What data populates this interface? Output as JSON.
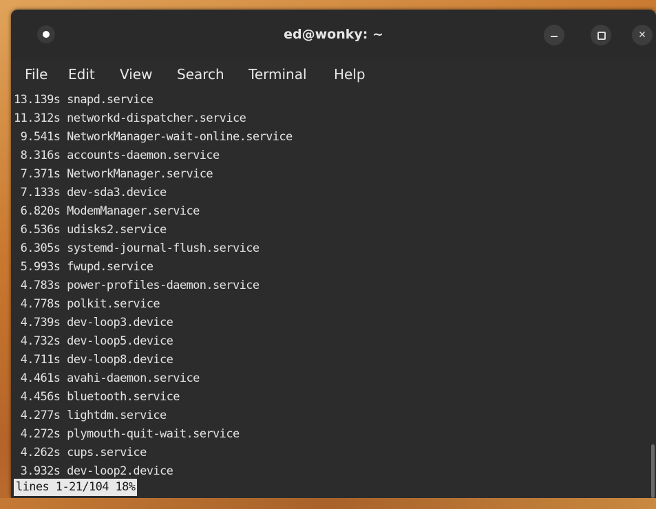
{
  "window": {
    "title": "ed@wonky: ~"
  },
  "menu": {
    "items": [
      {
        "label": "File"
      },
      {
        "label": "Edit"
      },
      {
        "label": "View"
      },
      {
        "label": "Search"
      },
      {
        "label": "Terminal"
      },
      {
        "label": "Help"
      }
    ]
  },
  "terminal": {
    "lines": [
      "13.139s snapd.service",
      "11.312s networkd-dispatcher.service",
      " 9.541s NetworkManager-wait-online.service",
      " 8.316s accounts-daemon.service",
      " 7.371s NetworkManager.service",
      " 7.133s dev-sda3.device",
      " 6.820s ModemManager.service",
      " 6.536s udisks2.service",
      " 6.305s systemd-journal-flush.service",
      " 5.993s fwupd.service",
      " 4.783s power-profiles-daemon.service",
      " 4.778s polkit.service",
      " 4.739s dev-loop3.device",
      " 4.732s dev-loop5.device",
      " 4.711s dev-loop8.device",
      " 4.461s avahi-daemon.service",
      " 4.456s bluetooth.service",
      " 4.277s lightdm.service",
      " 4.272s plymouth-quit-wait.service",
      " 4.262s cups.service",
      " 3.932s dev-loop2.device"
    ],
    "status": "lines 1-21/104 18%"
  },
  "icons": {
    "window_menu": "window-menu-icon",
    "minimize": "minimize-icon",
    "maximize": "maximize-icon",
    "close": "close-icon"
  },
  "colors": {
    "background": "#2c2c2c",
    "text": "#e3e3e3",
    "status_bg": "#e8e8e8"
  }
}
